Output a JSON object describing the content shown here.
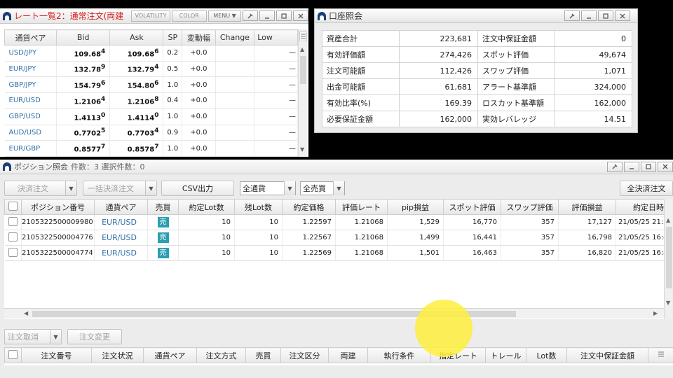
{
  "rate_panel": {
    "title": "レート一覧2：通常注文(両建",
    "buttons": {
      "volatility": "VOLATILITY",
      "color": "COLOR",
      "menu": "MENU ▼"
    },
    "columns": [
      "通貨ペア",
      "Bid",
      "Ask",
      "SP",
      "変動幅",
      "Change",
      "Low"
    ],
    "rows": [
      {
        "pair": "USD/JPY",
        "bid": "109.68",
        "bid_sup": "4",
        "ask": "109.68",
        "ask_sup": "6",
        "sp": "0.2",
        "change": "+0.0",
        "low": "—"
      },
      {
        "pair": "EUR/JPY",
        "bid": "132.78",
        "bid_sup": "9",
        "ask": "132.79",
        "ask_sup": "4",
        "sp": "0.5",
        "change": "+0.0",
        "low": "—"
      },
      {
        "pair": "GBP/JPY",
        "bid": "154.79",
        "bid_sup": "6",
        "ask": "154.80",
        "ask_sup": "6",
        "sp": "1.0",
        "change": "+0.0",
        "low": "—"
      },
      {
        "pair": "EUR/USD",
        "bid": "1.2106",
        "bid_sup": "4",
        "ask": "1.2106",
        "ask_sup": "8",
        "sp": "0.4",
        "change": "+0.0",
        "low": "—"
      },
      {
        "pair": "GBP/USD",
        "bid": "1.4113",
        "bid_sup": "0",
        "ask": "1.4114",
        "ask_sup": "0",
        "sp": "1.0",
        "change": "+0.0",
        "low": "—"
      },
      {
        "pair": "AUD/USD",
        "bid": "0.7702",
        "bid_sup": "5",
        "ask": "0.7703",
        "ask_sup": "4",
        "sp": "0.9",
        "change": "+0.0",
        "low": "—"
      },
      {
        "pair": "EUR/GBP",
        "bid": "0.8577",
        "bid_sup": "7",
        "ask": "0.8578",
        "ask_sup": "7",
        "sp": "1.0",
        "change": "+0.0",
        "low": "—"
      }
    ]
  },
  "account_panel": {
    "title": "口座照会",
    "rows": [
      {
        "l1": "資産合計",
        "v1": "223,681",
        "l2": "注文中保証金額",
        "v2": "0"
      },
      {
        "l1": "有効評価額",
        "v1": "274,426",
        "l2": "スポット評価",
        "v2": "49,674"
      },
      {
        "l1": "注文可能額",
        "v1": "112,426",
        "l2": "スワップ評価",
        "v2": "1,071"
      },
      {
        "l1": "出金可能額",
        "v1": "61,681",
        "l2": "アラート基準額",
        "v2": "324,000"
      },
      {
        "l1": "有効比率(%)",
        "v1": "169.39",
        "l2": "ロスカット基準額",
        "v2": "162,000"
      },
      {
        "l1": "必要保証金額",
        "v1": "162,000",
        "l2": "実効レバレッジ",
        "v2": "14.51"
      }
    ]
  },
  "position_panel": {
    "title": "ポジション照会",
    "count_text": "件数：3 選択件数：0",
    "toolbar": {
      "settle": "決済注文",
      "bulk_settle": "一括決済注文",
      "csv": "CSV出力",
      "currency_select": "全通貨",
      "side_select": "全売買",
      "all_settle": "全決済注文"
    },
    "columns": [
      "ポジション番号",
      "通貨ペア",
      "売買",
      "約定Lot数",
      "残Lot数",
      "約定価格",
      "評価レート",
      "pip損益",
      "スポット評価",
      "スワップ評価",
      "評価損益",
      "約定日時"
    ],
    "rows": [
      {
        "id": "2105322500009980",
        "pair": "EUR/USD",
        "side": "売",
        "lot": "10",
        "remain": "10",
        "price": "1.22597",
        "rate": "1.21068",
        "pip": "1,529",
        "spot": "16,770",
        "swap": "357",
        "pnl": "17,127",
        "date": "21/05/25 21:3"
      },
      {
        "id": "2105322500004776",
        "pair": "EUR/USD",
        "side": "売",
        "lot": "10",
        "remain": "10",
        "price": "1.22567",
        "rate": "1.21068",
        "pip": "1,499",
        "spot": "16,441",
        "swap": "357",
        "pnl": "16,798",
        "date": "21/05/25 16:4"
      },
      {
        "id": "2105322500004774",
        "pair": "EUR/USD",
        "side": "売",
        "lot": "10",
        "remain": "10",
        "price": "1.22569",
        "rate": "1.21068",
        "pip": "1,501",
        "spot": "16,463",
        "swap": "357",
        "pnl": "16,820",
        "date": "21/05/25 16:4"
      }
    ]
  },
  "order_panel": {
    "toolbar": {
      "cancel": "注文取消",
      "change": "注文変更"
    },
    "columns": [
      "注文番号",
      "注文状況",
      "通貨ペア",
      "注文方式",
      "売買",
      "注文区分",
      "両建",
      "執行条件",
      "指定レート",
      "トレール",
      "Lot数",
      "注文中保証金額"
    ]
  }
}
